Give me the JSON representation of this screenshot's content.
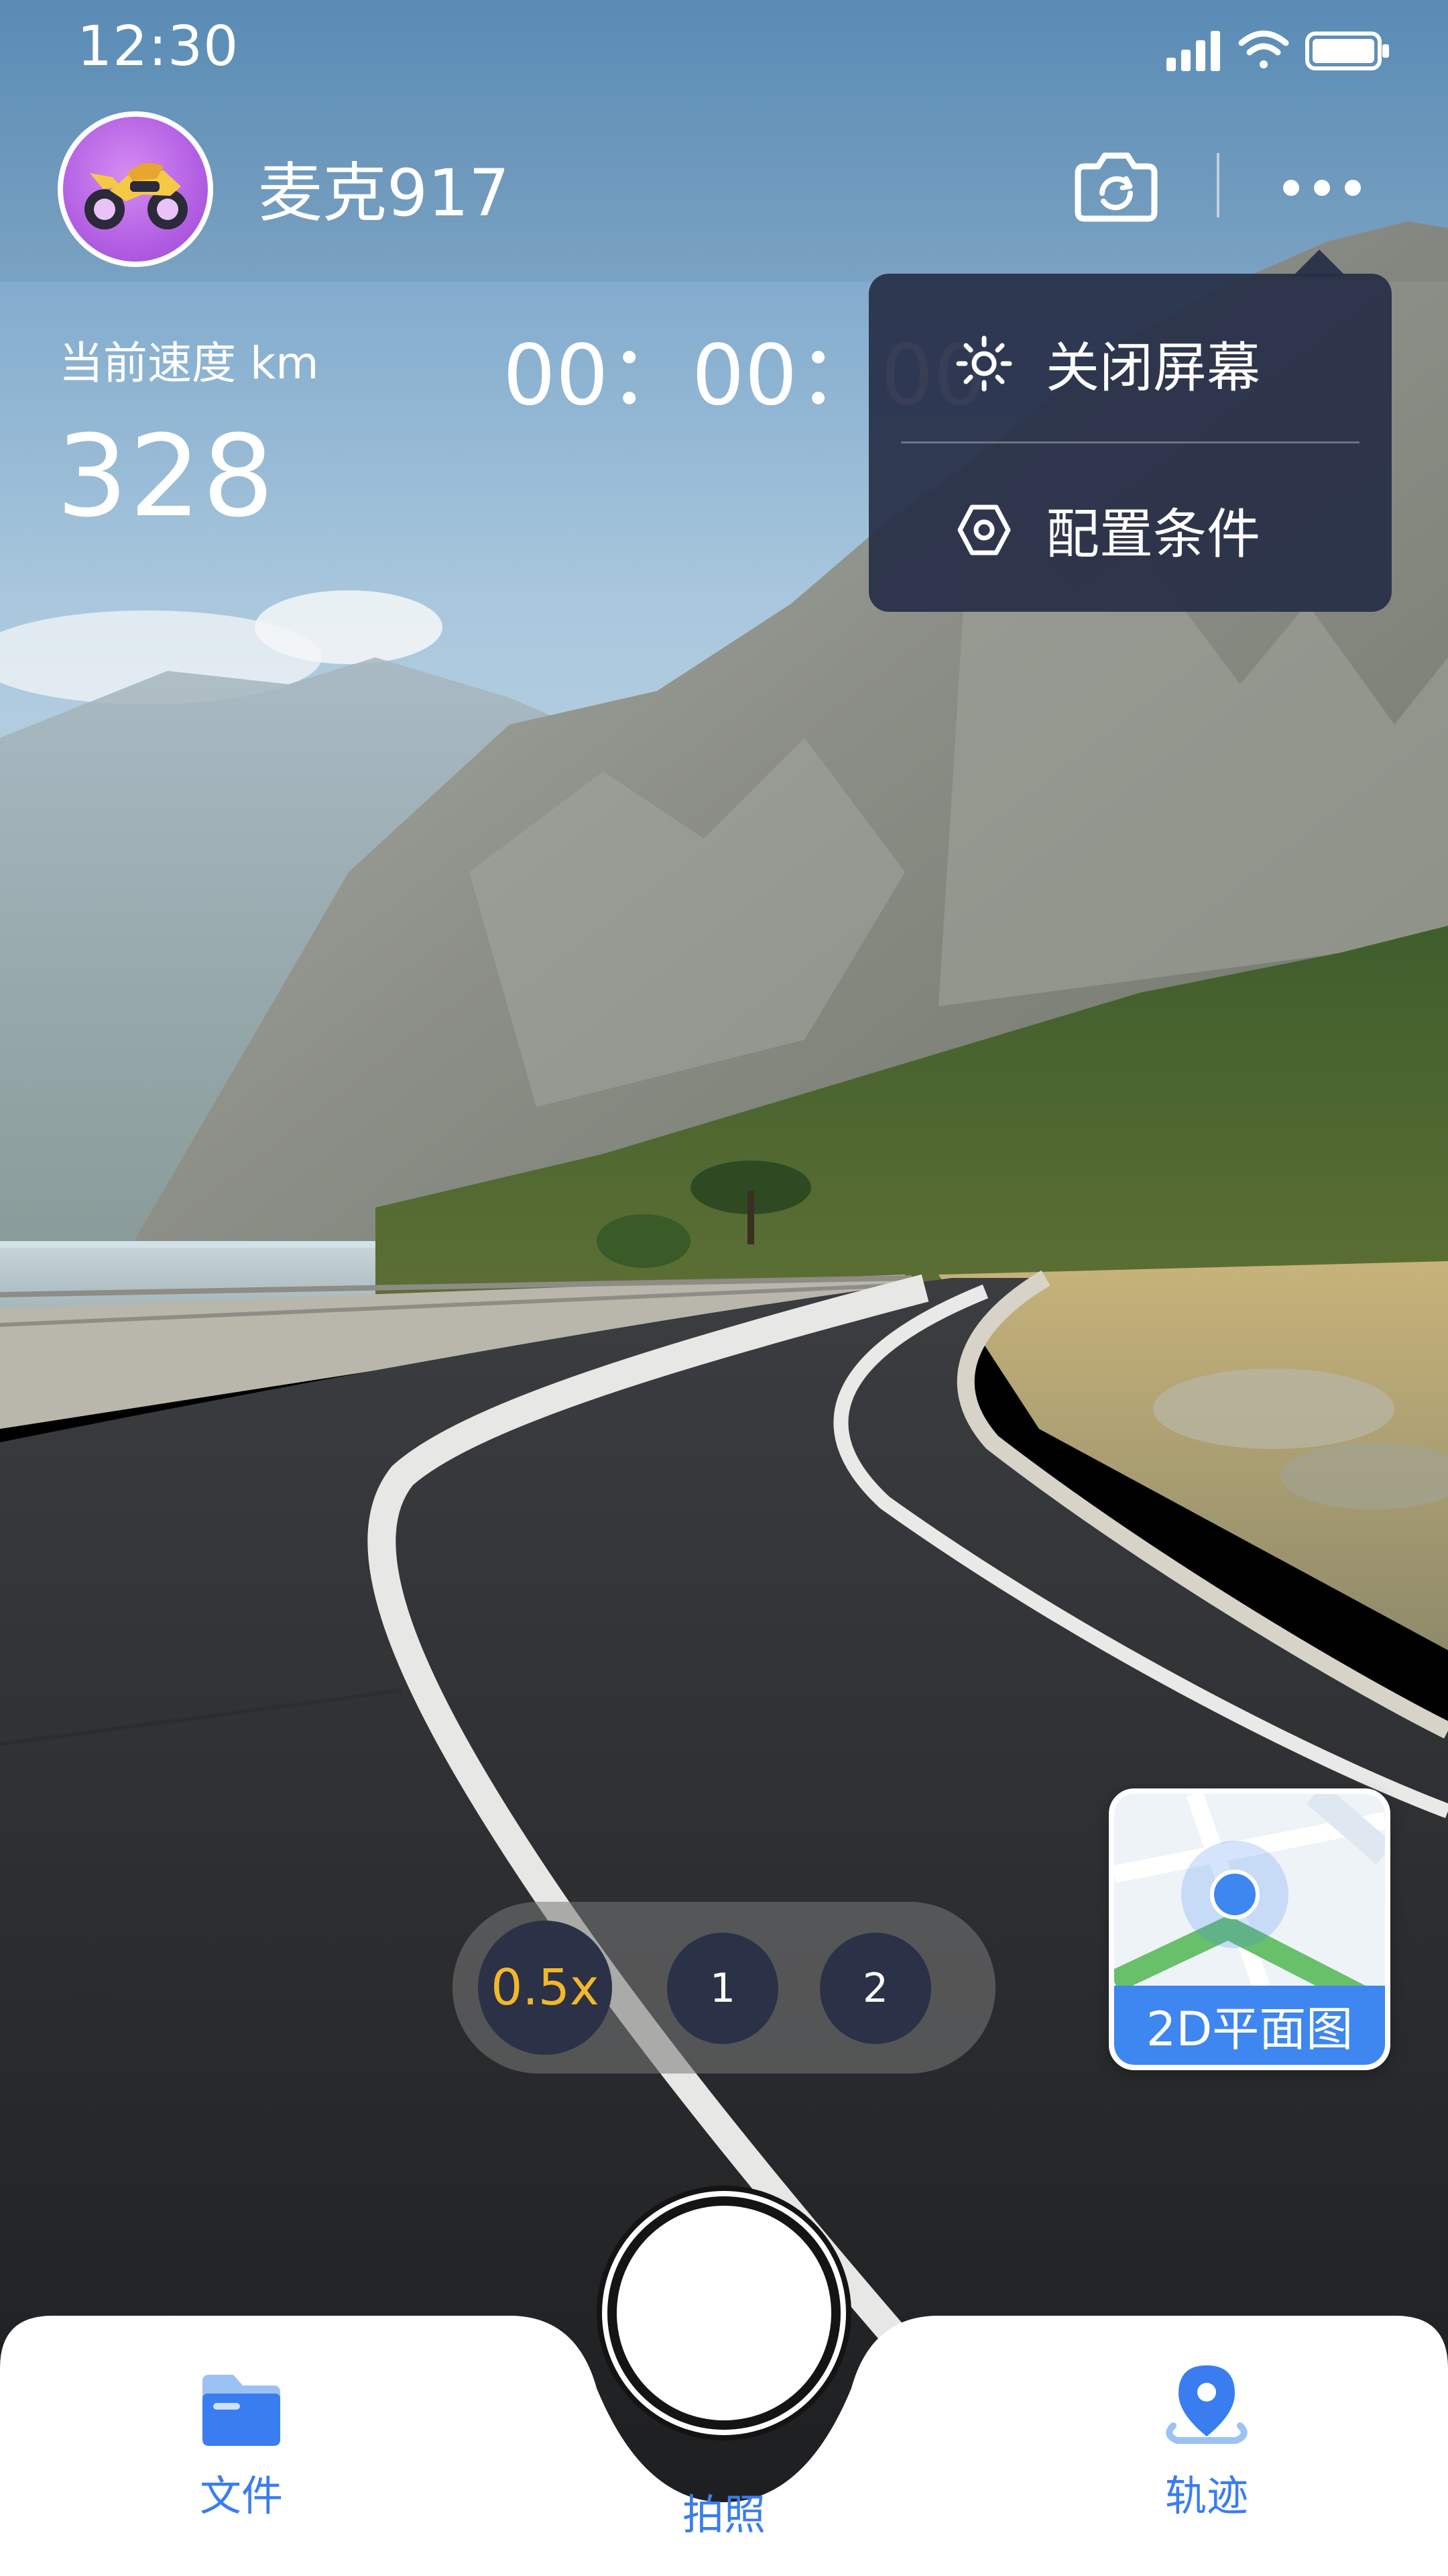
{
  "status_bar": {
    "time": "12:30",
    "icons": [
      "signal-icon",
      "wifi-icon",
      "battery-icon"
    ]
  },
  "header": {
    "avatar_icon": "motorcycle-avatar-icon",
    "username": "麦克917",
    "flip_camera_icon": "flip-camera-icon",
    "more_icon": "more-icon"
  },
  "stats": {
    "speed_label": "当前速度 km",
    "speed_value": "328",
    "timer": "00：00：00"
  },
  "dropdown_menu": {
    "items": [
      {
        "label": "关闭屏幕",
        "icon": "brightness-icon"
      },
      {
        "label": "配置条件",
        "icon": "settings-icon"
      }
    ]
  },
  "zoom": {
    "options": [
      "0.5x",
      "1",
      "2"
    ],
    "selected": "0.5x"
  },
  "map_card": {
    "label": "2D平面图",
    "icon": "location-pin-icon"
  },
  "bottom_nav": {
    "items": [
      {
        "label": "文件",
        "icon": "folder-icon"
      },
      {
        "label": "拍照",
        "icon": "shutter-icon"
      },
      {
        "label": "轨迹",
        "icon": "track-pin-icon"
      }
    ]
  },
  "colors": {
    "accent": "#3a7df0",
    "menu_bg": "#262e46",
    "zoom_active_text": "#f4b72a",
    "zoom_btn_bg": "#2b3147"
  }
}
